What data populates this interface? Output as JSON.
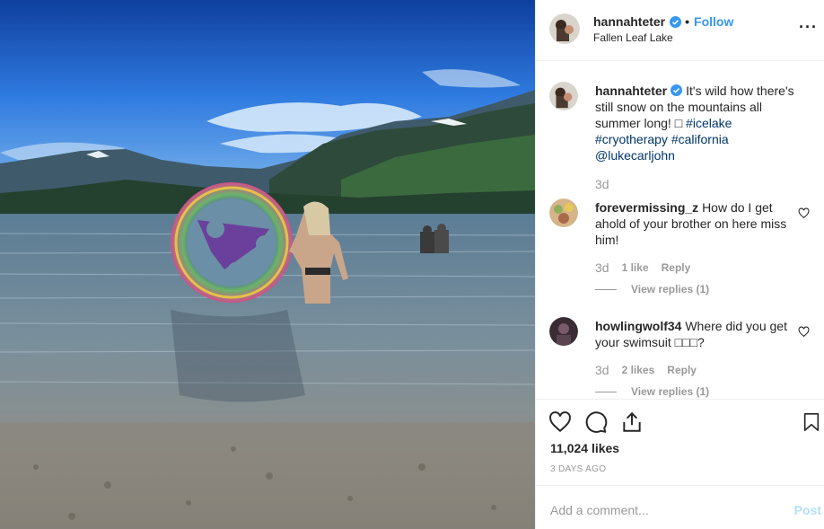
{
  "post": {
    "username": "hannahteter",
    "follow_label": "Follow",
    "location": "Fallen Leaf Lake",
    "more_label": "···"
  },
  "caption": {
    "username": "hannahteter",
    "text_before": "It's wild how there's still snow on the mountains all summer long! □ ",
    "hashtags": [
      "#icelake",
      "#cryotherapy",
      "#california"
    ],
    "mention": "@lukecarljohn",
    "time": "3d"
  },
  "comments": [
    {
      "username": "forevermissing_z",
      "text": "How do I get ahold of your brother on here miss him!",
      "time": "3d",
      "likes": "1 like",
      "reply_label": "Reply",
      "view_replies": "View replies (1)"
    },
    {
      "username": "howlingwolf34",
      "text": "Where did you get your swimsuit □□□?",
      "time": "3d",
      "likes": "2 likes",
      "reply_label": "Reply",
      "view_replies": "View replies (1)"
    }
  ],
  "actions": {
    "icons": [
      "heart-icon",
      "comment-icon",
      "share-icon",
      "bookmark-icon"
    ],
    "likes_count": "11,024 likes",
    "posted_ago": "3 DAYS AGO"
  },
  "add_comment": {
    "placeholder": "Add a comment...",
    "post_label": "Post"
  },
  "colors": {
    "link_blue": "#3897f0",
    "hashtag": "#003569",
    "muted": "#999999",
    "post_disabled": "#b2dffc"
  }
}
